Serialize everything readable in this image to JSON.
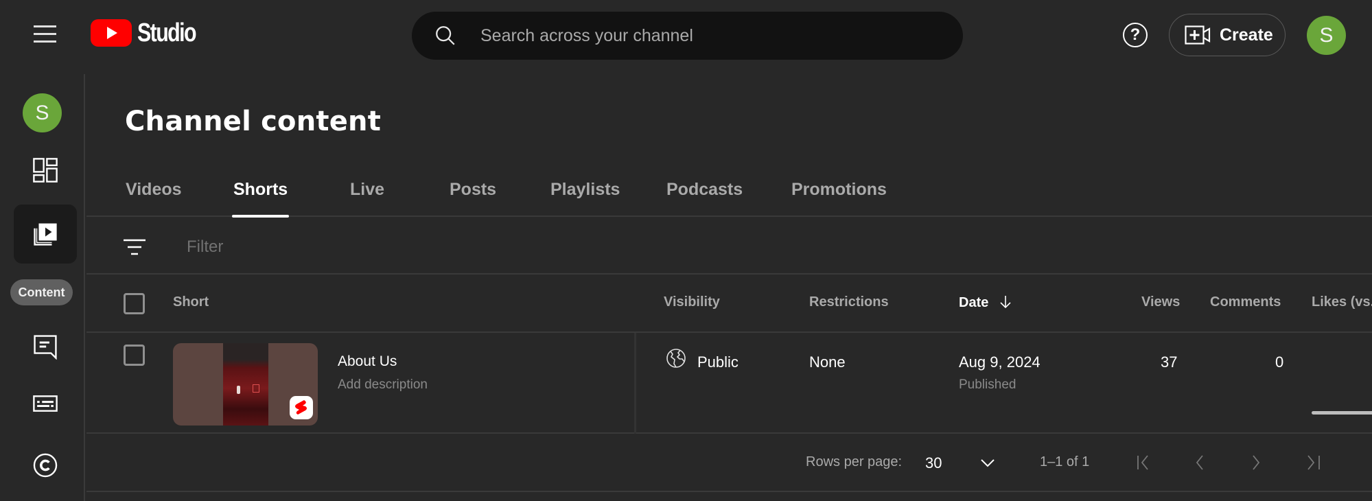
{
  "header": {
    "logo_text": "Studio",
    "search_placeholder": "Search across your channel",
    "help_label": "?",
    "create_label": "Create",
    "avatar_initial": "S"
  },
  "colors": {
    "background": "#282828",
    "brand_red": "#ff0000",
    "avatar_green": "#6aa63a"
  },
  "sidebar": {
    "avatar_initial": "S",
    "items": [
      {
        "name": "dashboard",
        "icon": "dashboard-icon",
        "active": false
      },
      {
        "name": "content",
        "icon": "content-icon",
        "active": true
      },
      {
        "name": "comments",
        "icon": "comments-icon",
        "active": false
      },
      {
        "name": "subtitles",
        "icon": "subtitles-icon",
        "active": false
      },
      {
        "name": "copyright",
        "icon": "copyright-icon",
        "active": false
      }
    ],
    "tooltip": "Content"
  },
  "main": {
    "title": "Channel content",
    "tabs": [
      {
        "label": "Videos",
        "active": false
      },
      {
        "label": "Shorts",
        "active": true
      },
      {
        "label": "Live",
        "active": false
      },
      {
        "label": "Posts",
        "active": false
      },
      {
        "label": "Playlists",
        "active": false
      },
      {
        "label": "Podcasts",
        "active": false
      },
      {
        "label": "Promotions",
        "active": false
      }
    ],
    "filter_placeholder": "Filter",
    "table": {
      "columns": [
        "Short",
        "Visibility",
        "Restrictions",
        "Date",
        "Views",
        "Comments",
        "Likes (vs."
      ],
      "sort_column": "Date",
      "sort_direction": "descending",
      "rows": [
        {
          "title": "About Us",
          "description": "Add description",
          "visibility": "Public",
          "restrictions": "None",
          "date": "Aug 9, 2024",
          "date_status": "Published",
          "views": "37",
          "comments": "0"
        }
      ]
    },
    "pagination": {
      "rows_per_page_label": "Rows per page:",
      "rows_per_page": "30",
      "range": "1–1 of 1"
    }
  }
}
